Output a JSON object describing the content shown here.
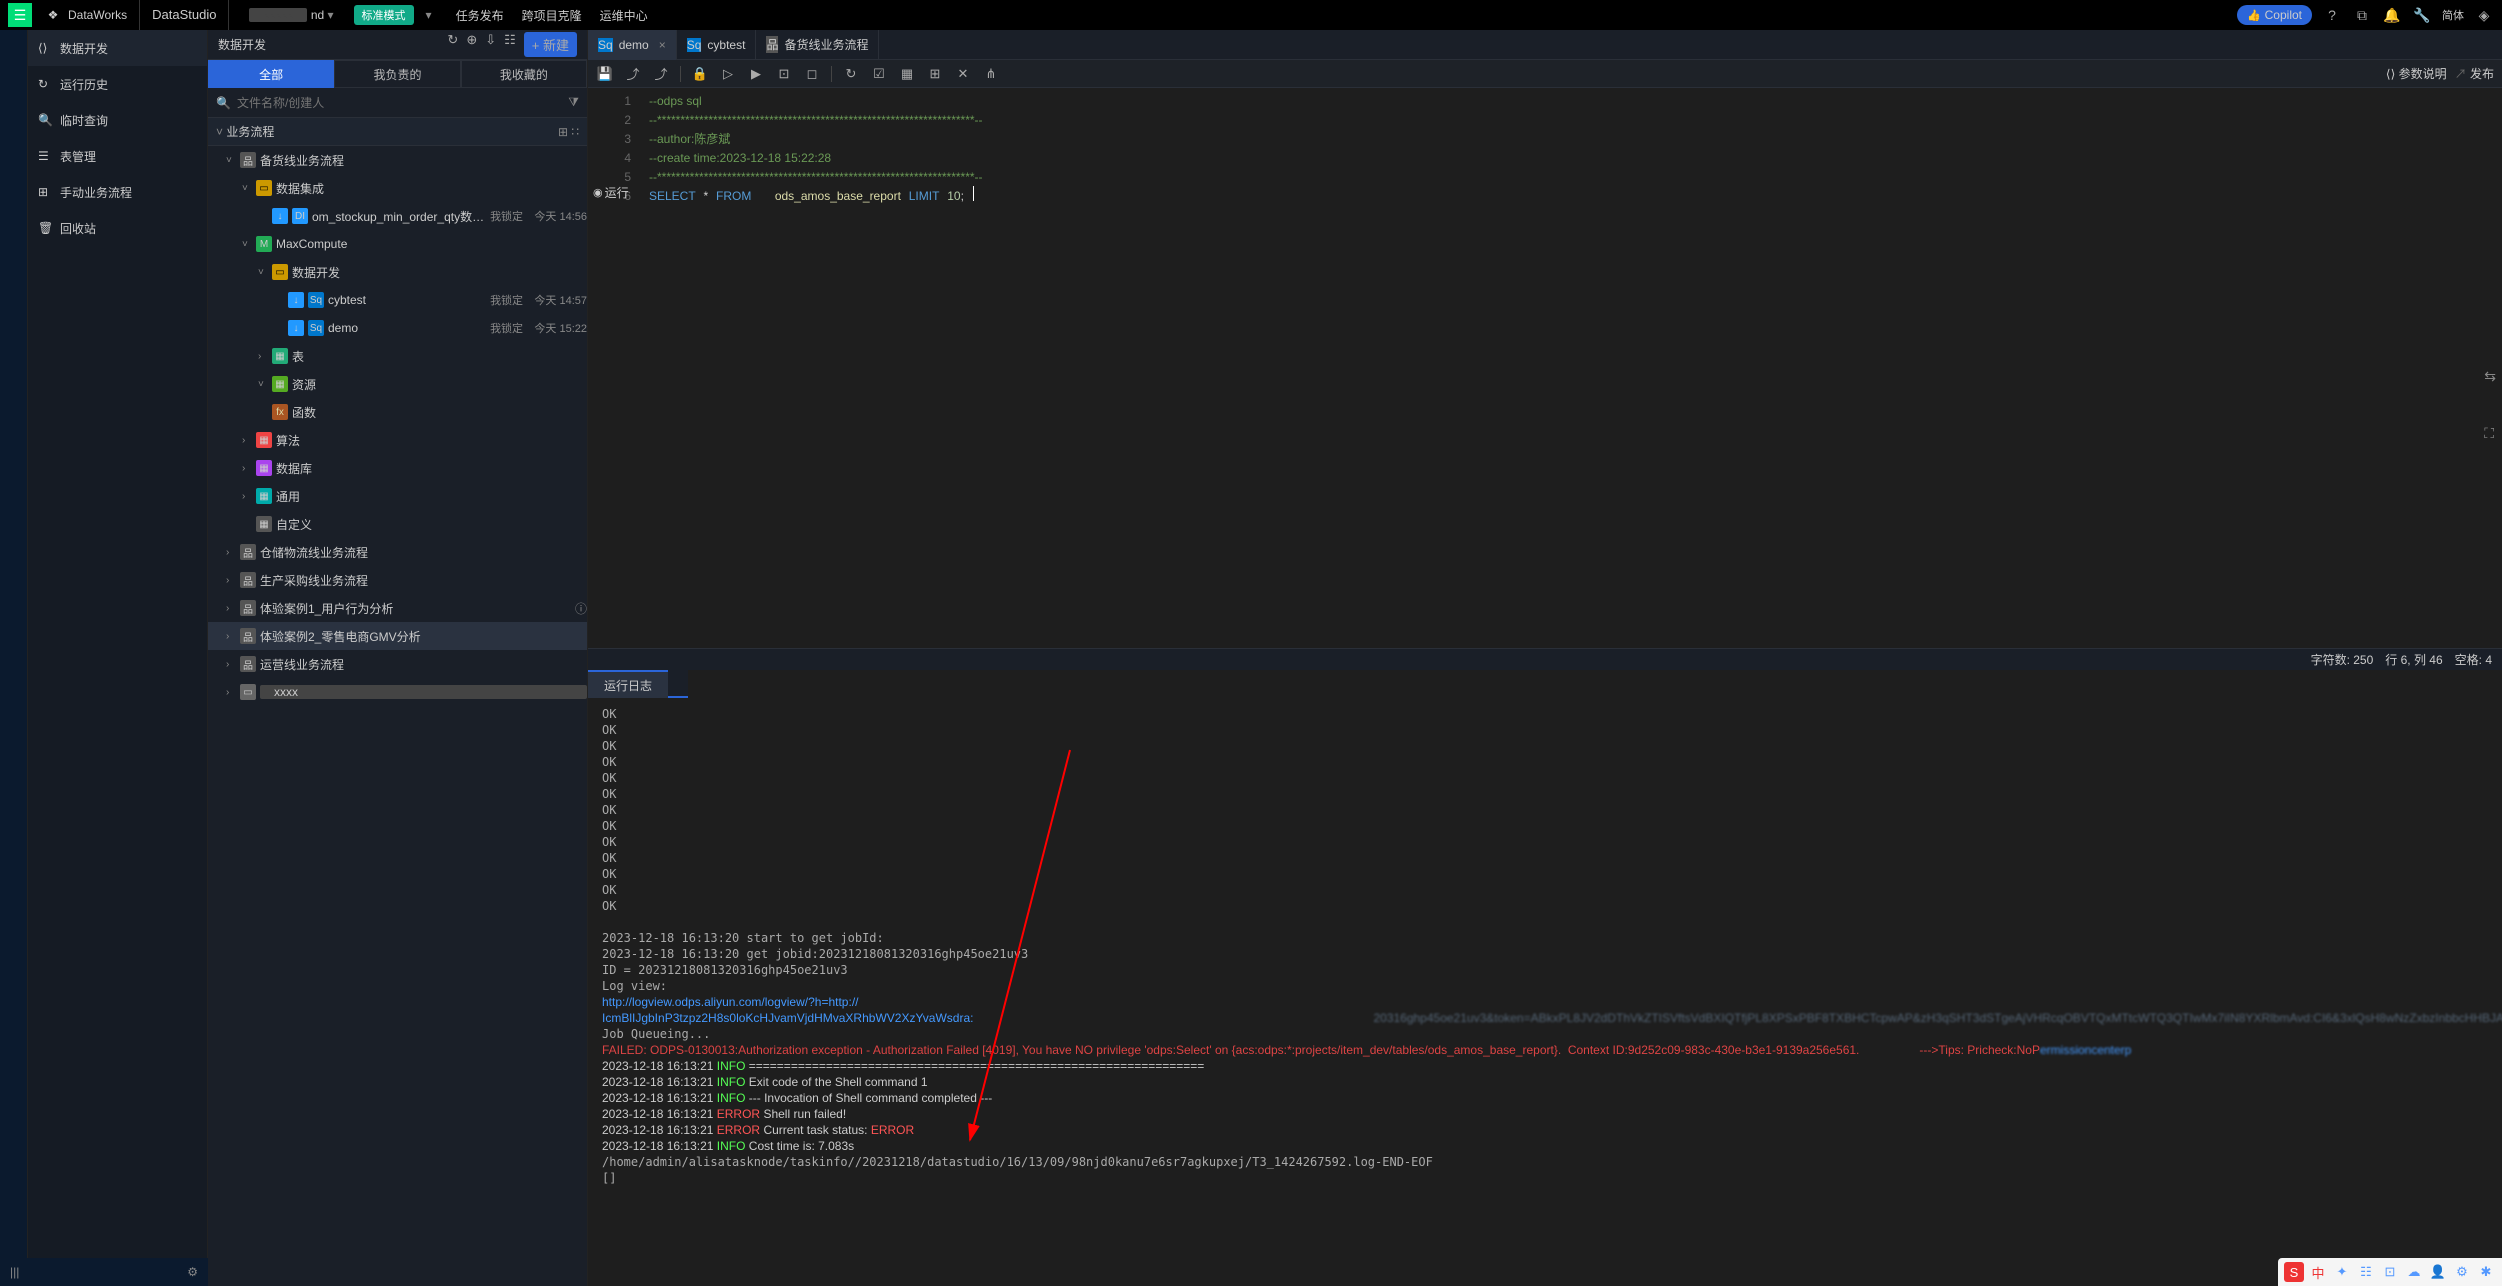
{
  "topbar": {
    "brand": "DataWorks",
    "product": "DataStudio",
    "project_redacted": "nd",
    "mode_badge": "标准模式",
    "nav": [
      "任务发布",
      "跨项目克隆",
      "运维中心"
    ],
    "copilot": "Copilot",
    "lang": "简体"
  },
  "navcol": {
    "items": [
      {
        "label": "数据开发",
        "active": true
      },
      {
        "label": "运行历史"
      },
      {
        "label": "临时查询"
      },
      {
        "label": "表管理"
      },
      {
        "label": "手动业务流程"
      },
      {
        "label": "回收站"
      }
    ]
  },
  "tree": {
    "header": "数据开发",
    "new_btn": "+ 新建",
    "filter_tabs": [
      "全部",
      "我负责的",
      "我收藏的"
    ],
    "active_filter": 0,
    "search_placeholder": "文件名称/创建人",
    "group": "业务流程",
    "nodes": {
      "root": "备货线业务流程",
      "di": "数据集成",
      "di_job": "om_stockup_min_order_qty数据同步",
      "di_job_meta1": "我锁定",
      "di_job_meta2": "今天 14:56",
      "mc": "MaxCompute",
      "dev": "数据开发",
      "cybtest": "cybtest",
      "cybtest_meta1": "我锁定",
      "cybtest_meta2": "今天 14:57",
      "demo": "demo",
      "demo_meta1": "我锁定",
      "demo_meta2": "今天 15:22",
      "table": "表",
      "res": "资源",
      "func": "函数",
      "algo": "算法",
      "db": "数据库",
      "gen": "通用",
      "cus": "自定义",
      "f2": "仓储物流线业务流程",
      "f3": "生产采购线业务流程",
      "f4": "体验案例1_用户行为分析",
      "f5": "体验案例2_零售电商GMV分析",
      "f6": "运营线业务流程"
    }
  },
  "editor": {
    "tabs": [
      {
        "icon": "sql",
        "label": "demo",
        "active": true,
        "closable": true
      },
      {
        "icon": "sql",
        "label": "cybtest"
      },
      {
        "icon": "flow",
        "label": "备货线业务流程"
      }
    ],
    "toolbar_right": {
      "param": "参数说明",
      "publish": "发布"
    },
    "run_btn": "运行",
    "code_lines": [
      {
        "n": 1,
        "cm": "--odps sql"
      },
      {
        "n": 2,
        "cm": "--********************************************************************--"
      },
      {
        "n": 3,
        "cm": "--author:陈彦斌"
      },
      {
        "n": 4,
        "cm": "--create time:2023-12-18 15:22:28"
      },
      {
        "n": 5,
        "cm": "--********************************************************************--"
      },
      {
        "n": 6
      }
    ],
    "sql": {
      "select": "SELECT",
      "star": "*",
      "from": "FROM",
      "table": "ods_amos_base_report",
      "limit": "LIMIT",
      "num": "10"
    },
    "status": {
      "chars": "字符数: 250",
      "pos": "行 6, 列 46",
      "blank": "空格: 4"
    }
  },
  "log": {
    "tab": "运行日志",
    "ok": "OK",
    "start": "2023-12-18 16:13:20 start to get jobId:",
    "getjob": "2023-12-18 16:13:20 get jobid:20231218081320316ghp45oe21uv3",
    "id": "ID = 20231218081320316ghp45oe21uv3",
    "logview": "Log view:",
    "url1": "http://logview.odps.aliyun.com/logview/?h=http://",
    "url2": "IcmBlIJgbInP3tzpz2H8s0loKcHJvamVjdHMvaXRhbWV2XzYvaWsdra:",
    "blur_tail": "20316ghp45oe21uv3&token=ABkxPL8JV2dDThVkZTISVftsVdBXIQTfjPL8XPSxPBF8TXBHCTcpwAP&zH3qSHT3dSTgeAjVHRcqOBVTQxMTtcWTQ3QTIwMx7iIN8YXRlbmAvd:CI6&3xlQsH8wNzZxbzInbbcHHBJAHVZC3dLC2F2oKZiYXQlIj8o6nd",
    "queue": "Job Queueing...",
    "fail": "FAILED: ODPS-0130013:Authorization exception - Authorization Failed [4019], You have NO privilege 'odps:Select' on {acs:odps:*:projects/item_dev/tables/ods_amos_base_report}.  Context ID:9d252c09-983c-430e-b3e1-9139a256e561.",
    "fail_tip": "--->Tips: Pricheck:NoP",
    "dash": "2023-12-18 16:13:21 INFO =================================================================",
    "exit": "2023-12-18 16:13:21 INFO Exit code of the Shell command 1",
    "invo": "2023-12-18 16:13:21 INFO --- Invocation of Shell command completed ---",
    "runfail": "2023-12-18 16:13:21 ERROR Shell run failed!",
    "curstat": "2023-12-18 16:13:21 ERROR Current task status: ERROR",
    "cost": "2023-12-18 16:13:21 INFO Cost time is: 7.083s",
    "path": "/home/admin/alisatasknode/taskinfo//20231218/datastudio/16/13/09/98njd0kanu7e6sr7agkupxej/T3_1424267592.log-END-EOF",
    "prompt": "[]"
  }
}
